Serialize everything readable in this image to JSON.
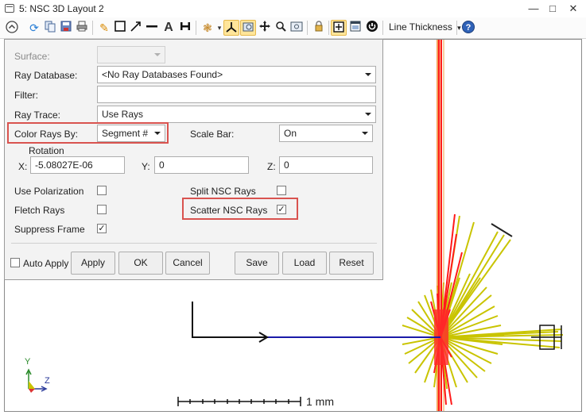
{
  "window": {
    "title": "5: NSC 3D Layout 2"
  },
  "toolbar": {
    "line_thickness_label": "Line Thickness",
    "dropdown_arrow": "▾"
  },
  "panel": {
    "surface": {
      "label": "Surface:",
      "value": ""
    },
    "ray_database": {
      "label": "Ray Database:",
      "value": "<No Ray Databases Found>"
    },
    "filter": {
      "label": "Filter:",
      "value": ""
    },
    "ray_trace": {
      "label": "Ray Trace:",
      "value": "Use Rays"
    },
    "color_rays_by": {
      "label": "Color Rays By:",
      "value": "Segment #"
    },
    "scale_bar": {
      "label": "Scale Bar:",
      "value": "On"
    },
    "rotation": {
      "label": "Rotation",
      "x_label": "X:",
      "x_value": "-5.08027E-06",
      "y_label": "Y:",
      "y_value": "0",
      "z_label": "Z:",
      "z_value": "0"
    },
    "use_polarization": {
      "label": "Use Polarization",
      "checked": false
    },
    "split_nsc_rays": {
      "label": "Split NSC Rays",
      "checked": false
    },
    "fletch_rays": {
      "label": "Fletch Rays",
      "checked": false
    },
    "scatter_nsc_rays": {
      "label": "Scatter NSC Rays",
      "checked": true
    },
    "suppress_frame": {
      "label": "Suppress Frame",
      "checked": true
    },
    "auto_apply": {
      "label": "Auto Apply",
      "checked": false
    },
    "buttons": {
      "apply": "Apply",
      "ok": "OK",
      "cancel": "Cancel",
      "save": "Save",
      "load": "Load",
      "reset": "Reset"
    }
  },
  "viewport": {
    "scale_bar_label": "1 mm",
    "axis_y_label": "Y",
    "axis_z_label": "Z"
  },
  "colors": {
    "highlight_box": "#d9534f",
    "ray_blue": "#1a1aa8",
    "ray_red": "#ff1a1a",
    "ray_yellow": "#c9c400",
    "ray_orange": "#f08020"
  }
}
